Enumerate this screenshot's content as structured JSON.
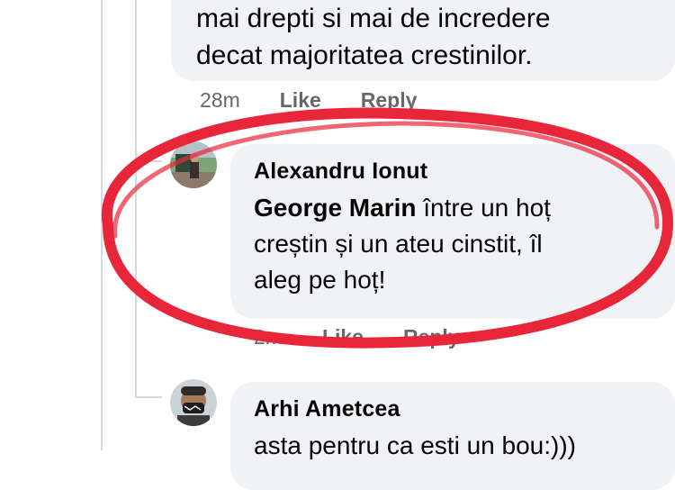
{
  "top_comment": {
    "text_line_1": "mai drepti si mai de incredere",
    "text_line_2": "decat majoritatea crestinilor.",
    "time": "28m",
    "like_label": "Like",
    "reply_label": "Reply"
  },
  "reply_1": {
    "author": "Alexandru Ionut",
    "mention": "George Marin",
    "text_line_1_rest": " între un hoț",
    "text_line_2": "creștin și un ateu cinstit, îl",
    "text_line_3": "aleg pe hoț!",
    "time": "2m",
    "like_label": "Like",
    "reply_label": "Reply",
    "avatar_icon": "person-photo-avatar"
  },
  "reply_2": {
    "author": "Arhi Ametcea",
    "text_line_1": "asta pentru ca esti un bou:)))",
    "avatar_icon": "masked-person-avatar"
  },
  "colors": {
    "bubble": "#f0f2f5",
    "text": "#050505",
    "meta": "#65676b",
    "highlight_circle": "#e8263a"
  }
}
